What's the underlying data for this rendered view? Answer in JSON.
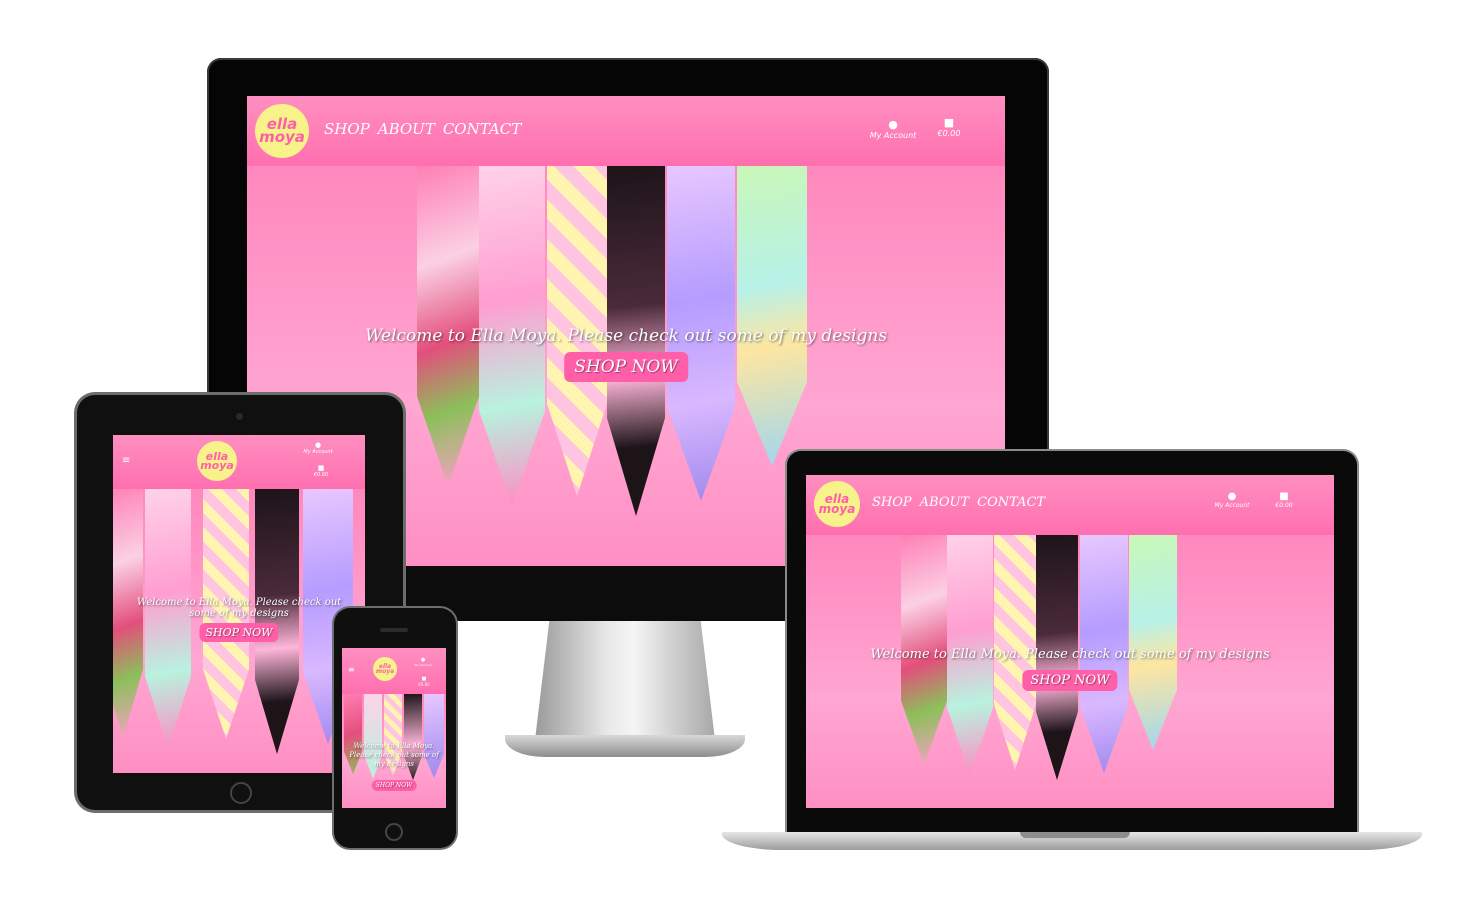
{
  "brand": {
    "logo_line1": "ella",
    "logo_line2": "moya"
  },
  "nav": {
    "shop": "SHOP",
    "about": "ABOUT",
    "contact": "CONTACT"
  },
  "utility": {
    "account_label": "My Account",
    "cart_total": "€0.00"
  },
  "hero": {
    "welcome_text": "Welcome to Ella Moya. Please check out some of my designs",
    "cta_label": "SHOP NOW"
  },
  "icons": {
    "account": "user-icon",
    "cart": "shopping-bag-icon",
    "menu": "hamburger-menu-icon"
  },
  "colors": {
    "header": "#ff6fb0",
    "hero_bg": "#ffa6d2",
    "logo_bg": "#f7f28a",
    "cta": "#ff5ea8"
  }
}
